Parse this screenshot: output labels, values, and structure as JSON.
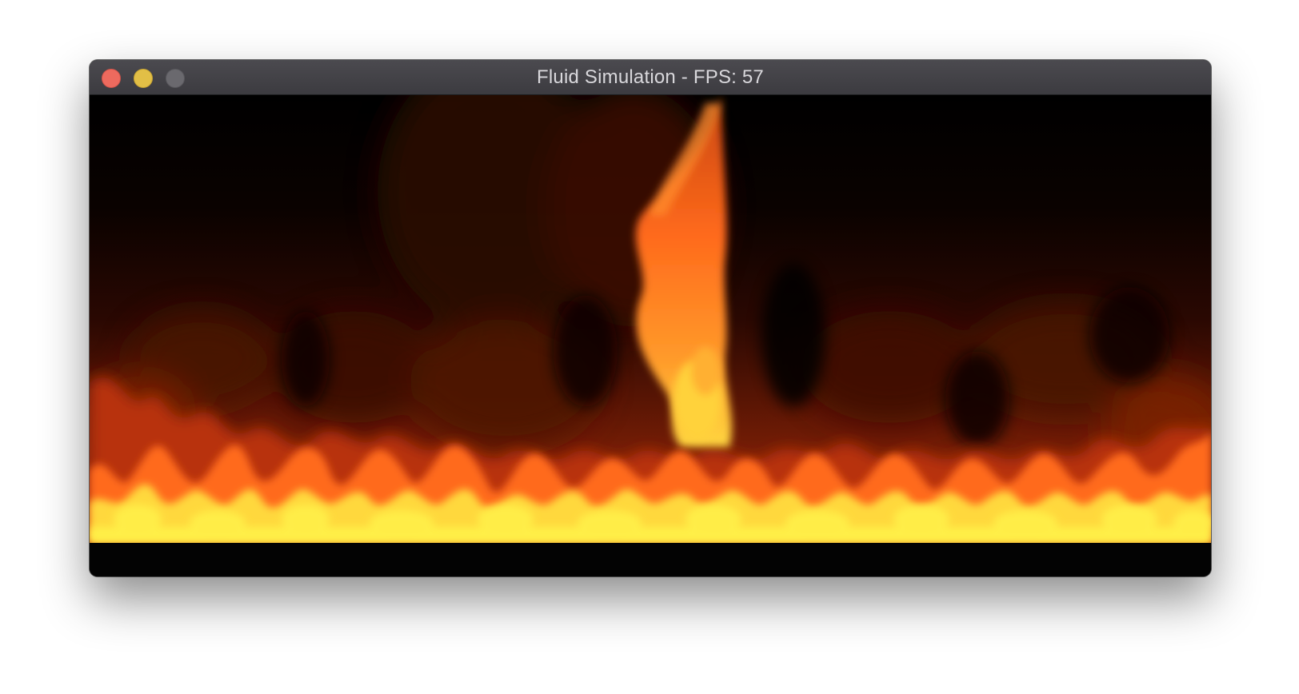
{
  "window": {
    "title": "Fluid Simulation - FPS: 57"
  },
  "titlebar": {
    "buttons": [
      {
        "name": "close",
        "icon": "close-button-icon",
        "color": "#ed6a5e"
      },
      {
        "name": "minimize",
        "icon": "minimize-button-icon",
        "color": "#e2bf46"
      },
      {
        "name": "zoom",
        "icon": "zoom-button-icon",
        "color": "#6a696e"
      }
    ]
  },
  "simulation": {
    "palette": {
      "background": "#000000",
      "ember": "#3a0d02",
      "flame_red": "#c8340a",
      "flame_orange": "#ff7a1e",
      "flame_yellow": "#fff04a"
    }
  }
}
